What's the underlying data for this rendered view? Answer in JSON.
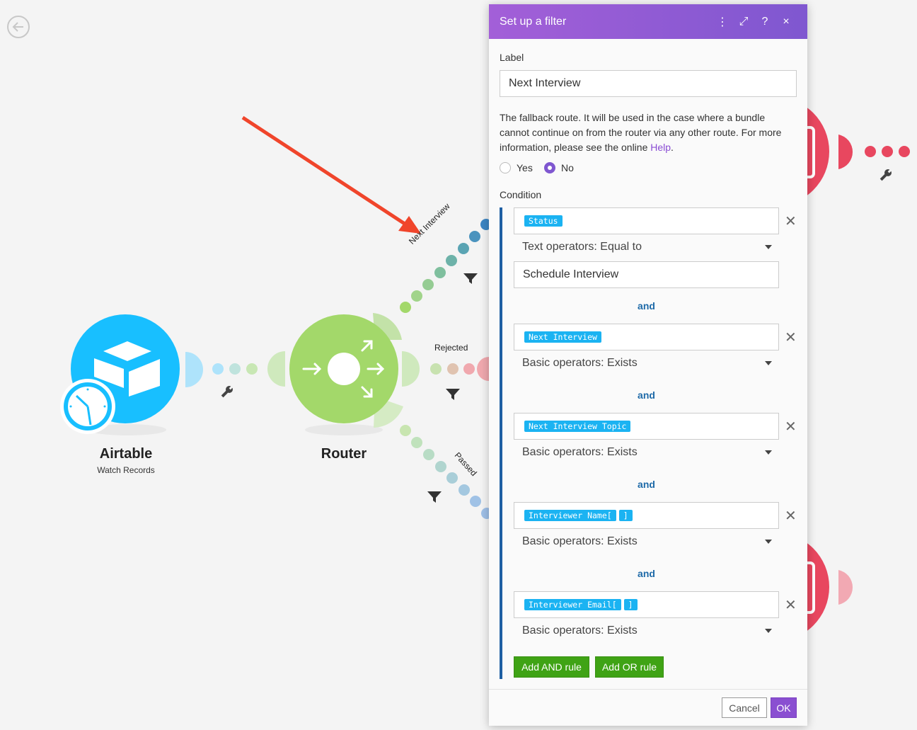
{
  "canvas": {
    "nodes": {
      "airtable": {
        "title": "Airtable",
        "subtitle": "Watch Records"
      },
      "router": {
        "title": "Router"
      }
    },
    "routes": {
      "next_interview": "Next Interview",
      "rejected": "Rejected",
      "passed": "Passed"
    },
    "colors": {
      "airtable": "#18bfff",
      "router": "#a3d86a",
      "module": "#e8475f",
      "arrow": "#f0452b"
    }
  },
  "panel": {
    "title": "Set up a filter",
    "header_icons": [
      "more-vertical-icon",
      "expand-icon",
      "help-icon",
      "close-icon"
    ],
    "header_glyphs": {
      "more": "⋮",
      "expand": "⤢",
      "help": "?",
      "close": "×"
    },
    "label_heading": "Label",
    "label_value": "Next Interview",
    "fallback_text": "The fallback route. It will be used in the case where a bundle cannot continue on from the router via any other route. For more information, please see the online",
    "help_link": "Help",
    "period": ".",
    "radio": {
      "yes": "Yes",
      "no": "No",
      "selected": "No"
    },
    "condition_heading": "Condition",
    "remove_glyph": "✕",
    "rules": [
      {
        "chips": [
          "Status"
        ],
        "operator": "Text operators: Equal to",
        "value": "Schedule Interview"
      },
      {
        "chips": [
          "Next Interview"
        ],
        "operator": "Basic operators: Exists"
      },
      {
        "chips": [
          "Next Interview Topic"
        ],
        "operator": "Basic operators: Exists"
      },
      {
        "chips": [
          "Interviewer Name[",
          "]"
        ],
        "operator": "Basic operators: Exists"
      },
      {
        "chips": [
          "Interviewer Email[",
          "]"
        ],
        "operator": "Basic operators: Exists"
      }
    ],
    "and_label": "and",
    "add_and_rule": "Add AND rule",
    "add_or_rule": "Add OR rule",
    "cancel": "Cancel",
    "ok": "OK"
  }
}
